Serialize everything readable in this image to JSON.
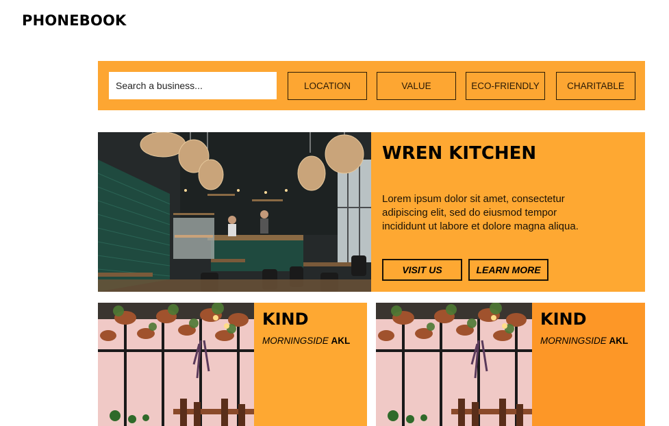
{
  "header": {
    "logo": "PHONEBOOK"
  },
  "search": {
    "placeholder": "Search a business...",
    "filters": [
      "LOCATION",
      "VALUE",
      "ECO-FRIENDLY",
      "CHARITABLE"
    ]
  },
  "featured": {
    "title": "WREN KITCHEN",
    "description": "Lorem ipsum dolor sit amet, consectetur adipiscing elit, sed do eiusmod tempor incididunt ut labore et dolore magna aliqua.",
    "buttons": {
      "visit": "VISIT US",
      "learn": "LEARN MORE"
    },
    "image": "cafe-interior-photo"
  },
  "listings": [
    {
      "title": "KIND",
      "suburb": "MORNINGSIDE",
      "city": "AKL",
      "color": "#fea832",
      "image": "hanging-plants-restaurant-photo"
    },
    {
      "title": "KIND",
      "suburb": "MORNINGSIDE",
      "city": "AKL",
      "color": "#fd9727",
      "image": "hanging-plants-restaurant-photo"
    }
  ],
  "colors": {
    "accent": "#fda632",
    "text": "#000000"
  }
}
